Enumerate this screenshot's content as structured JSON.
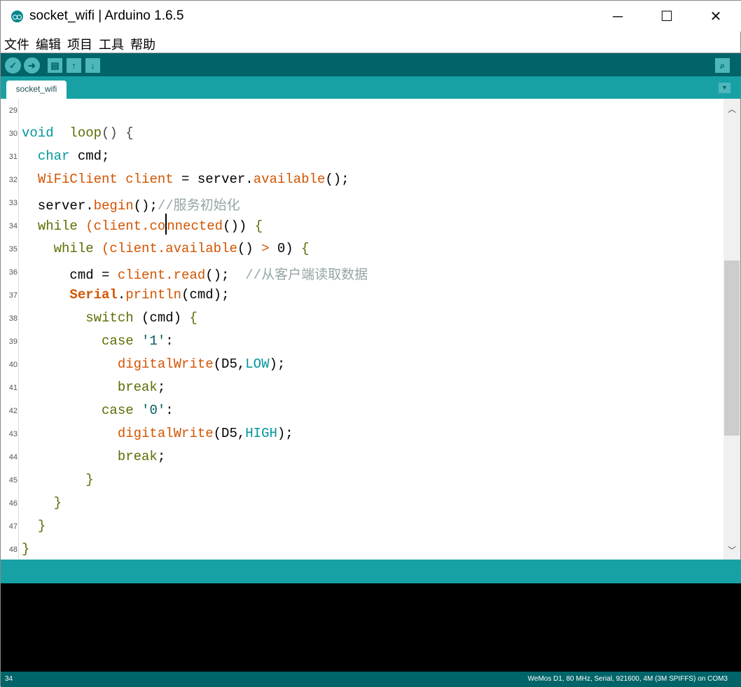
{
  "window": {
    "title": "socket_wifi | Arduino 1.6.5",
    "minimize": "─",
    "maximize": "☐",
    "close": "✕"
  },
  "menu": [
    "文件",
    "编辑",
    "项目",
    "工具",
    "帮助"
  ],
  "toolbar": {
    "verify": "✓",
    "upload": "➜",
    "new": "▤",
    "open": "↑",
    "save": "↓",
    "serial_monitor": "⌕"
  },
  "tab": {
    "label": "socket_wifi",
    "menu": "▼"
  },
  "code": {
    "lines": [
      {
        "n": "29",
        "tokens": []
      },
      {
        "n": "30",
        "tokens": [
          [
            "k",
            "void"
          ],
          [
            "",
            "  "
          ],
          [
            "c",
            "loop"
          ],
          [
            "p",
            "() {"
          ]
        ]
      },
      {
        "n": "31",
        "tokens": [
          [
            "",
            "  "
          ],
          [
            "k",
            "char"
          ],
          [
            "",
            " cmd;"
          ]
        ]
      },
      {
        "n": "32",
        "tokens": [
          [
            "",
            "  "
          ],
          [
            "f",
            "WiFiClient client"
          ],
          [
            "",
            " = server."
          ],
          [
            "f",
            "available"
          ],
          [
            "",
            "();"
          ]
        ]
      },
      {
        "n": "33",
        "tokens": [
          [
            "",
            "  server."
          ],
          [
            "f",
            "begin"
          ],
          [
            "",
            "();"
          ],
          [
            "cm",
            "//服务初始化"
          ]
        ]
      },
      {
        "n": "34",
        "tokens": [
          [
            "",
            "  "
          ],
          [
            "c",
            "while"
          ],
          [
            "f",
            " (client.co"
          ],
          [
            "caret",
            ""
          ],
          [
            "f",
            "nnected"
          ],
          [
            "",
            "()) "
          ],
          [
            "c",
            "{"
          ]
        ]
      },
      {
        "n": "35",
        "tokens": [
          [
            "",
            "    "
          ],
          [
            "c",
            "while"
          ],
          [
            "f",
            " (client.available"
          ],
          [
            "",
            "() "
          ],
          [
            "f",
            ">"
          ],
          [
            "",
            " 0) "
          ],
          [
            "c",
            "{"
          ]
        ]
      },
      {
        "n": "36",
        "tokens": [
          [
            "",
            "      cmd = "
          ],
          [
            "f",
            "client.read"
          ],
          [
            "",
            "();  "
          ],
          [
            "cm",
            "//从客户端读取数据"
          ]
        ]
      },
      {
        "n": "37",
        "tokens": [
          [
            "",
            "      "
          ],
          [
            "b",
            "Serial"
          ],
          [
            "",
            "."
          ],
          [
            "f",
            "println"
          ],
          [
            "",
            "(cmd);"
          ]
        ]
      },
      {
        "n": "38",
        "tokens": [
          [
            "",
            "        "
          ],
          [
            "c",
            "switch"
          ],
          [
            "",
            " (cmd) "
          ],
          [
            "c",
            "{"
          ]
        ]
      },
      {
        "n": "39",
        "tokens": [
          [
            "",
            "          "
          ],
          [
            "c",
            "case"
          ],
          [
            "s",
            " '1'"
          ],
          [
            "",
            ":"
          ]
        ]
      },
      {
        "n": "40",
        "tokens": [
          [
            "",
            "            "
          ],
          [
            "f",
            "digitalWrite"
          ],
          [
            "",
            "(D5,"
          ],
          [
            "k",
            "LOW"
          ],
          [
            "",
            ");"
          ]
        ]
      },
      {
        "n": "41",
        "tokens": [
          [
            "",
            "            "
          ],
          [
            "c",
            "break"
          ],
          [
            "",
            ";"
          ]
        ]
      },
      {
        "n": "42",
        "tokens": [
          [
            "",
            "          "
          ],
          [
            "c",
            "case"
          ],
          [
            "s",
            " '0'"
          ],
          [
            "",
            ":"
          ]
        ]
      },
      {
        "n": "43",
        "tokens": [
          [
            "",
            "            "
          ],
          [
            "f",
            "digitalWrite"
          ],
          [
            "",
            "(D5,"
          ],
          [
            "k",
            "HIGH"
          ],
          [
            "",
            ");"
          ]
        ]
      },
      {
        "n": "44",
        "tokens": [
          [
            "",
            "            "
          ],
          [
            "c",
            "break"
          ],
          [
            "",
            ";"
          ]
        ]
      },
      {
        "n": "45",
        "tokens": [
          [
            "",
            "        "
          ],
          [
            "c",
            "}"
          ]
        ]
      },
      {
        "n": "46",
        "tokens": [
          [
            "",
            "    "
          ],
          [
            "c",
            "}"
          ]
        ]
      },
      {
        "n": "47",
        "tokens": [
          [
            "",
            "  "
          ],
          [
            "c",
            "}"
          ]
        ]
      },
      {
        "n": "48",
        "tokens": [
          [
            "c",
            "}"
          ]
        ]
      }
    ]
  },
  "scroll": {
    "up": "︿",
    "down": "﹀",
    "position_fraction": 0.58
  },
  "status": {
    "line": "34",
    "board": "WeMos D1, 80 MHz, Serial, 921600, 4M (3M SPIFFS) on COM3"
  }
}
